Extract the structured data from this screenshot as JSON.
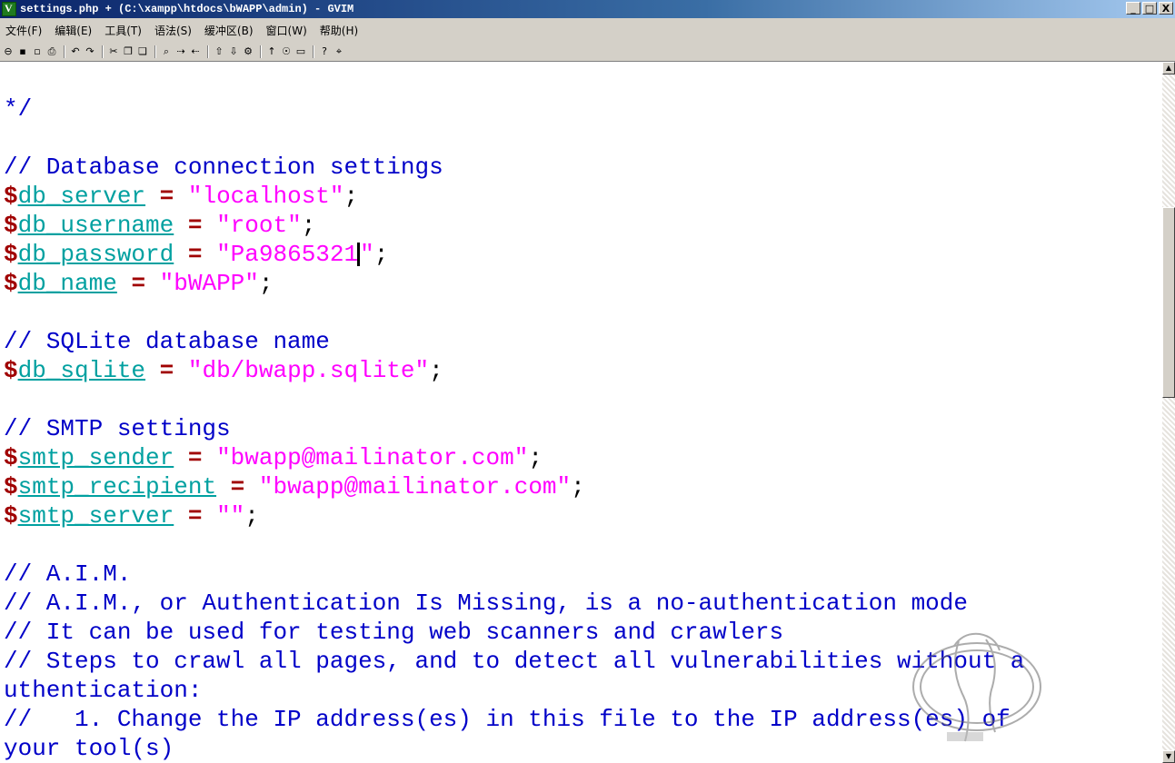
{
  "window": {
    "title": "settings.php + (C:\\xampp\\htdocs\\bWAPP\\admin) - GVIM",
    "controls": [
      "_",
      "□",
      "X"
    ]
  },
  "menu": [
    "文件(F)",
    "编辑(E)",
    "工具(T)",
    "语法(S)",
    "缓冲区(B)",
    "窗口(W)",
    "帮助(H)"
  ],
  "toolbar": {
    "buttons": [
      "open-icon",
      "save-icon",
      "save-all-icon",
      "print-icon",
      "undo-icon",
      "redo-icon",
      "cut-icon",
      "copy-icon",
      "paste-icon",
      "find-icon",
      "find-next-icon",
      "find-prev-icon",
      "load-session-icon",
      "save-session-icon",
      "run-script-icon",
      "make-icon",
      "ctags-icon",
      "jump-tag-icon",
      "help-icon",
      "find-help-icon"
    ]
  },
  "code": {
    "l1": "*/",
    "db_comment": "// Database connection settings",
    "db_server_var": "db_server",
    "db_server_val": "\"localhost\"",
    "db_username_var": "db_username",
    "db_username_val": "\"root\"",
    "db_password_var": "db_password",
    "db_password_val": "\"Pa9865321",
    "db_name_var": "db_name",
    "db_name_val": "\"bWAPP\"",
    "sqlite_comment": "// SQLite database name",
    "db_sqlite_var": "db_sqlite",
    "db_sqlite_val": "\"db/bwapp.sqlite\"",
    "smtp_comment": "// SMTP settings",
    "smtp_sender_var": "smtp_sender",
    "smtp_sender_val": "\"bwapp@mailinator.com\"",
    "smtp_recipient_var": "smtp_recipient",
    "smtp_recipient_val": "\"bwapp@mailinator.com\"",
    "smtp_server_var": "smtp_server",
    "smtp_server_val": "\"\"",
    "aim_comment1": "// A.I.M.",
    "aim_comment2": "// A.I.M., or Authentication Is Missing, is a no-authentication mode",
    "aim_comment3": "// It can be used for testing web scanners and crawlers",
    "aim_comment4a": "// Steps to crawl all pages, and to detect all vulnerabilities without a",
    "aim_comment4b": "uthentication:",
    "aim_comment5a": "//   1. Change the IP address(es) in this file to the IP address(es) of",
    "aim_comment5b": "your tool(s)"
  }
}
